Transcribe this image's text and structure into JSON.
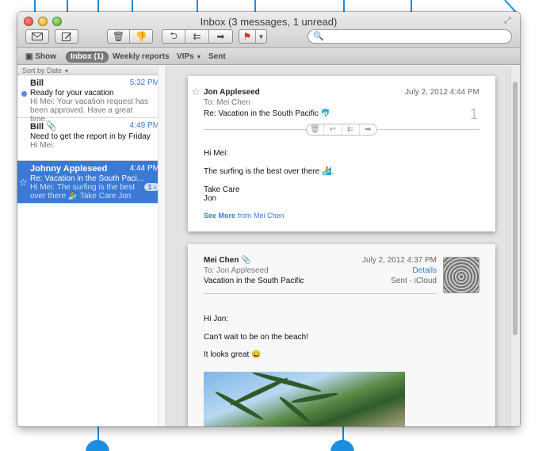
{
  "window": {
    "title": "Inbox (3 messages, 1 unread)"
  },
  "toolbar": {
    "get_mail_icon": "envelope-icon",
    "compose_icon": "compose-icon",
    "delete_icon": "trash-icon",
    "junk_icon": "thumbs-down-icon",
    "reply_icon": "reply-icon",
    "reply_all_icon": "reply-all-icon",
    "forward_icon": "forward-icon",
    "flag_icon": "flag-icon",
    "flag_color": "#e0302a",
    "search_placeholder": ""
  },
  "favorites": {
    "show_label": "Show",
    "inbox_label": "Inbox (1)",
    "weekly_label": "Weekly reports",
    "vips_label": "VIPs",
    "sent_label": "Sent"
  },
  "message_list": {
    "sort_label": "Sort by Date",
    "messages": [
      {
        "from": "Bill",
        "date": "5:32 PM",
        "subject": "Ready for your vacation",
        "preview": "Hi Mei: Your vacation request has been approved. Have a great time...",
        "unread": true
      },
      {
        "from": "Bill",
        "date": "4:49 PM",
        "subject": "Need to get the report in by Friday",
        "preview": "Hi Mei:",
        "attachment": true
      },
      {
        "from": "Johnny Appleseed",
        "date": "4:44 PM",
        "subject": "Re: Vacation in the South Paci...",
        "preview": "Hi Mei: The surfing is the best over there 🏄 Take Care Jon",
        "thread_count": "1",
        "selected": true
      }
    ]
  },
  "reader": {
    "msg1": {
      "from": "Jon Appleseed",
      "to": "To:  Mei Chen",
      "subject": "Re: Vacation in the South Pacific 🐬",
      "date": "July 2, 2012  4:44 PM",
      "count": "1",
      "greeting": "Hi Mei:",
      "line1": "The surfing is the best over there 🏄.",
      "signoff1": "Take Care",
      "signoff2": "Jon",
      "see_more": "See More",
      "see_more_from": "from Mei Chen"
    },
    "msg2": {
      "from": "Mei Chen",
      "to": "To:  Jon Appleseed",
      "subject": "Vacation in the South Pacific",
      "date": "July 2, 2012  4:37 PM",
      "details": "Details",
      "mailbox": "Sent - iCloud",
      "greeting": "Hi Jon:",
      "line1": "Can't wait to be on the beach!",
      "line2": "It looks great 😀"
    }
  },
  "colors": {
    "accent": "#3b7ad4",
    "callout": "#1b8ee0"
  }
}
